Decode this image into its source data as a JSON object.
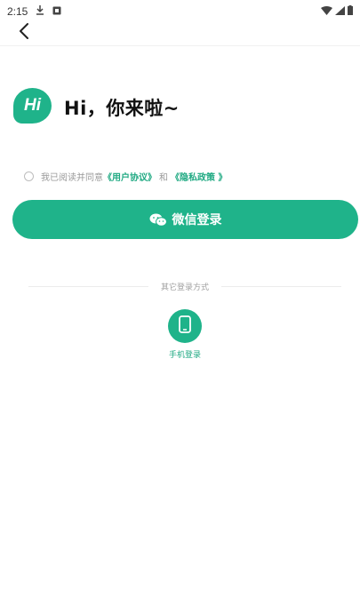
{
  "status_bar": {
    "time": "2:15",
    "icons": [
      "download-icon",
      "notification-icon",
      "wifi-icon",
      "signal-icon",
      "battery-icon"
    ]
  },
  "header": {
    "back_icon": "chevron-left-icon"
  },
  "hero": {
    "logo_text": "Hi",
    "greeting": "Hi，你来啦~"
  },
  "agreement": {
    "prefix": "我已阅读并同意",
    "user_agreement": "《用户协议》",
    "conjunction": "和",
    "privacy_policy": "《隐私政策 》"
  },
  "wechat_button": {
    "label": "微信登录",
    "icon": "wechat-icon"
  },
  "other_methods": {
    "title": "其它登录方式",
    "phone_login": {
      "label": "手机登录",
      "icon": "phone-icon"
    }
  },
  "colors": {
    "accent": "#1fb38a",
    "link": "#1fa982",
    "muted": "#9a9a9a"
  }
}
